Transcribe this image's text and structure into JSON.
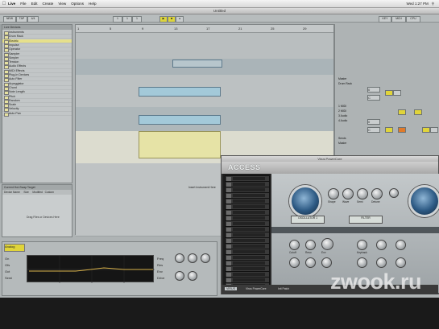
{
  "menubar": {
    "apple_icon": "apple-icon",
    "app_name": "Live",
    "items": [
      "File",
      "Edit",
      "Create",
      "View",
      "Options",
      "Help"
    ],
    "clock": "Wed 1:27 PM"
  },
  "window": {
    "title": "Untitled"
  },
  "transport": {
    "buttons": [
      "NEW",
      "TAP",
      "4/4",
      "1",
      "1",
      "1",
      "KEY",
      "MIDI",
      "CPU"
    ]
  },
  "browser": {
    "header": "Live Devices",
    "rows": [
      "Instruments",
      "Drum Rack",
      "Electric",
      "Impulse",
      "Operator",
      "Sampler",
      "Simpler",
      "Tension",
      "Audio Effects",
      "MIDI Effects",
      "Plug-In Devices",
      "Auto Filter",
      "Arpeggiator",
      "Chord",
      "Note Length",
      "Pitch",
      "Random",
      "Scale",
      "Velocity",
      "Auto Pan"
    ],
    "selected_index": 2
  },
  "info_panel": {
    "header": "Current Hot-Swap Target",
    "columns": [
      "Device Name",
      "Size",
      "Modified",
      "Custom"
    ],
    "text": "Drag Files or Devices Here"
  },
  "arrangement": {
    "ruler_marks": [
      "1",
      "5",
      "9",
      "13",
      "17",
      "21",
      "25",
      "29"
    ],
    "clip_label": "Insert Instrument Here"
  },
  "mixer": {
    "labels": [
      "Master",
      "Drum Rack",
      "1 MIDI",
      "2 MIDI",
      "3 Audio",
      "4 Audio",
      "Sends",
      "Master"
    ],
    "values": [
      "0",
      "C",
      "0",
      "C"
    ]
  },
  "detail": {
    "device_title": "Analog",
    "left_params": [
      "On",
      "Ofs",
      "Oct",
      "Semi"
    ],
    "right_params": [
      "Freq",
      "Res",
      "Env",
      "Drive"
    ]
  },
  "statusbar": {
    "text": "Insert Mark 1.1.1 (Time: 0:00)"
  },
  "virus": {
    "window_title": "Virus PowerCore",
    "logo": "ACCESS",
    "brand": "VIRUS",
    "lcd_left": "OSCILLATOR 1",
    "lcd_right": "FILTER",
    "knob_labels": [
      "Shape",
      "Wave",
      "Semi",
      "Detune",
      "Cutoff",
      "Reso",
      "Env",
      "Keytrack"
    ],
    "footer_left": "Virus PowerCore",
    "footer_right": "Init Patch"
  },
  "watermark": "zwook.ru"
}
